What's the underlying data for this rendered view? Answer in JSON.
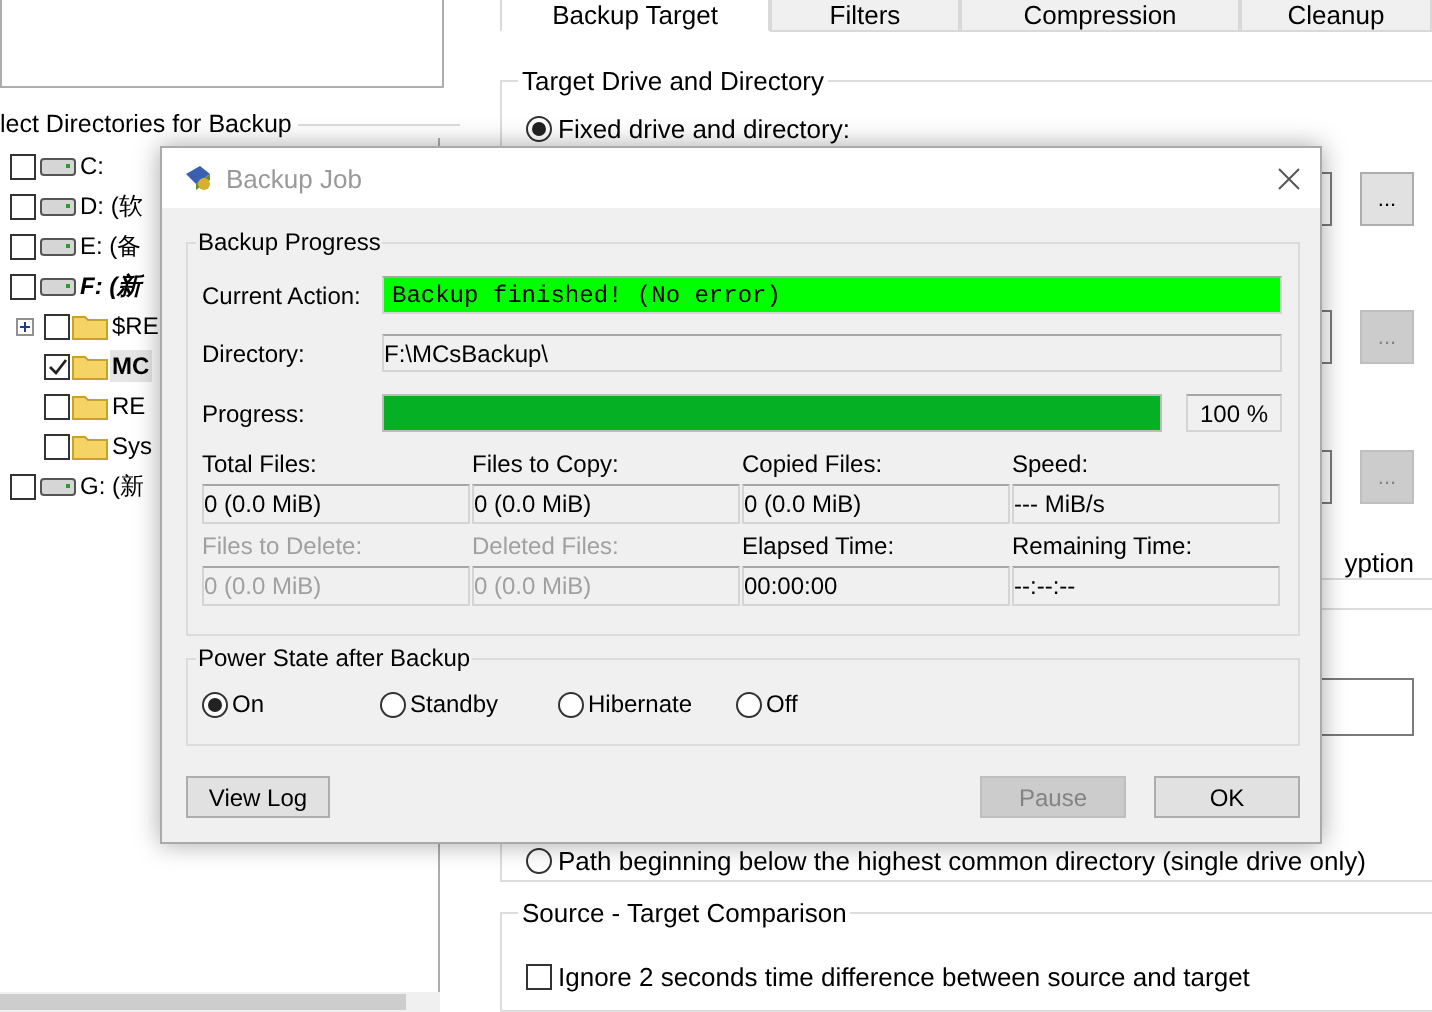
{
  "main_window": {
    "left_panel": {
      "group_title": "lect Directories for Backup",
      "tree": [
        {
          "label": "C:",
          "kind": "drive",
          "checked": false,
          "selected": false,
          "bold": false,
          "italic": false
        },
        {
          "label": "D: (软",
          "kind": "drive",
          "checked": false,
          "selected": false,
          "bold": false,
          "italic": false
        },
        {
          "label": "E: (备",
          "kind": "drive",
          "checked": false,
          "selected": false,
          "bold": false,
          "italic": false
        },
        {
          "label": "F: (新",
          "kind": "drive",
          "checked": false,
          "selected": false,
          "bold": true,
          "italic": true,
          "children": [
            {
              "label": "$RE",
              "kind": "folder",
              "checked": false,
              "selected": false,
              "bold": false,
              "italic": false,
              "expandable": true
            },
            {
              "label": "MC",
              "kind": "folder",
              "checked": true,
              "selected": true,
              "bold": true,
              "italic": false,
              "expandable": false
            },
            {
              "label": "RE",
              "kind": "folder",
              "checked": false,
              "selected": false,
              "bold": false,
              "italic": false,
              "expandable": false
            },
            {
              "label": "Sys",
              "kind": "folder",
              "checked": false,
              "selected": false,
              "bold": false,
              "italic": false,
              "expandable": false
            }
          ]
        },
        {
          "label": "G: (新",
          "kind": "drive",
          "checked": false,
          "selected": false,
          "bold": false,
          "italic": false
        }
      ]
    },
    "tabs": [
      {
        "label": "Backup Target",
        "selected": true
      },
      {
        "label": "Filters",
        "selected": false
      },
      {
        "label": "Compression",
        "selected": false
      },
      {
        "label": "Cleanup",
        "selected": false
      }
    ],
    "target_group": {
      "title": "Target Drive and Directory",
      "fixed_option": {
        "label": "Fixed drive and directory:",
        "selected": true
      },
      "browse_buttons": [
        {
          "label": "...",
          "disabled": false
        },
        {
          "label": "...",
          "disabled": true
        },
        {
          "label": "...",
          "disabled": true
        }
      ],
      "encryption_fragment": "yption"
    },
    "path_group": {
      "path_option": {
        "label": "Path beginning below the highest common directory (single drive only)",
        "selected": false
      }
    },
    "comparison_group": {
      "title": "Source - Target Comparison",
      "ignore_option": {
        "label": "Ignore 2 seconds time difference between source and target",
        "checked": false
      }
    }
  },
  "dialog": {
    "title": "Backup Job",
    "progress_group": {
      "title": "Backup Progress",
      "current_action": {
        "label": "Current Action:",
        "value": "Backup finished! (No error)"
      },
      "directory": {
        "label": "Directory:",
        "value": "F:\\MCsBackup\\"
      },
      "progress": {
        "label": "Progress:",
        "level": 1,
        "reading": "100 %"
      },
      "stats": [
        {
          "label": "Total Files:",
          "value": "0 (0.0 MiB)",
          "disabled": false
        },
        {
          "label": "Files to Copy:",
          "value": "0 (0.0 MiB)",
          "disabled": false
        },
        {
          "label": "Copied Files:",
          "value": "0 (0.0 MiB)",
          "disabled": false
        },
        {
          "label": "Speed:",
          "value": "--- MiB/s",
          "disabled": false
        },
        {
          "label": "Files to Delete:",
          "value": "0 (0.0 MiB)",
          "disabled": true
        },
        {
          "label": "Deleted Files:",
          "value": "0 (0.0 MiB)",
          "disabled": true
        },
        {
          "label": "Elapsed Time:",
          "value": "00:00:00",
          "disabled": false
        },
        {
          "label": "Remaining Time:",
          "value": "--:--:--",
          "disabled": false
        }
      ]
    },
    "power_group": {
      "title": "Power State after Backup",
      "options": [
        {
          "label": "On",
          "selected": true
        },
        {
          "label": "Standby",
          "selected": false
        },
        {
          "label": "Hibernate",
          "selected": false
        },
        {
          "label": "Off",
          "selected": false
        }
      ]
    },
    "buttons": [
      {
        "label": "View Log",
        "disabled": false
      },
      {
        "label": "Pause",
        "disabled": true
      },
      {
        "label": "OK",
        "disabled": false
      }
    ]
  }
}
